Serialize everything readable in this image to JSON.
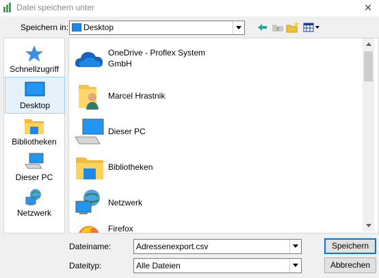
{
  "window": {
    "title": "Datei speichern unter"
  },
  "toolbar": {
    "lookin_label": "Speichern in:",
    "lookin_value": "Desktop"
  },
  "places": [
    {
      "label": "Schnellzugriff",
      "icon": "star-icon"
    },
    {
      "label": "Desktop",
      "icon": "desktop-icon",
      "selected": true
    },
    {
      "label": "Bibliotheken",
      "icon": "folder-icon"
    },
    {
      "label": "Dieser PC",
      "icon": "computer-icon"
    },
    {
      "label": "Netzwerk",
      "icon": "network-icon"
    }
  ],
  "files": [
    {
      "label": "OneDrive - Proflex System GmbH",
      "line1": "OneDrive - Proflex System",
      "line2": "GmbH",
      "icon": "cloud-icon"
    },
    {
      "label": "Marcel Hrastnik",
      "icon": "user-folder-icon"
    },
    {
      "label": "Dieser PC",
      "icon": "computer-icon"
    },
    {
      "label": "Bibliotheken",
      "icon": "folder-icon"
    },
    {
      "label": "Netzwerk",
      "icon": "network-icon"
    },
    {
      "label": "Firefox",
      "icon": "firefox-icon"
    }
  ],
  "bottom": {
    "filename_label": "Dateiname:",
    "filename_value": "Adressenexport.csv",
    "filetype_label": "Dateityp:",
    "filetype_value": "Alle Dateien",
    "save_label": "Speichern",
    "cancel_label": "Abbrechen"
  },
  "colors": {
    "accent": "#0078d7",
    "selection": "#e5f1fb"
  }
}
